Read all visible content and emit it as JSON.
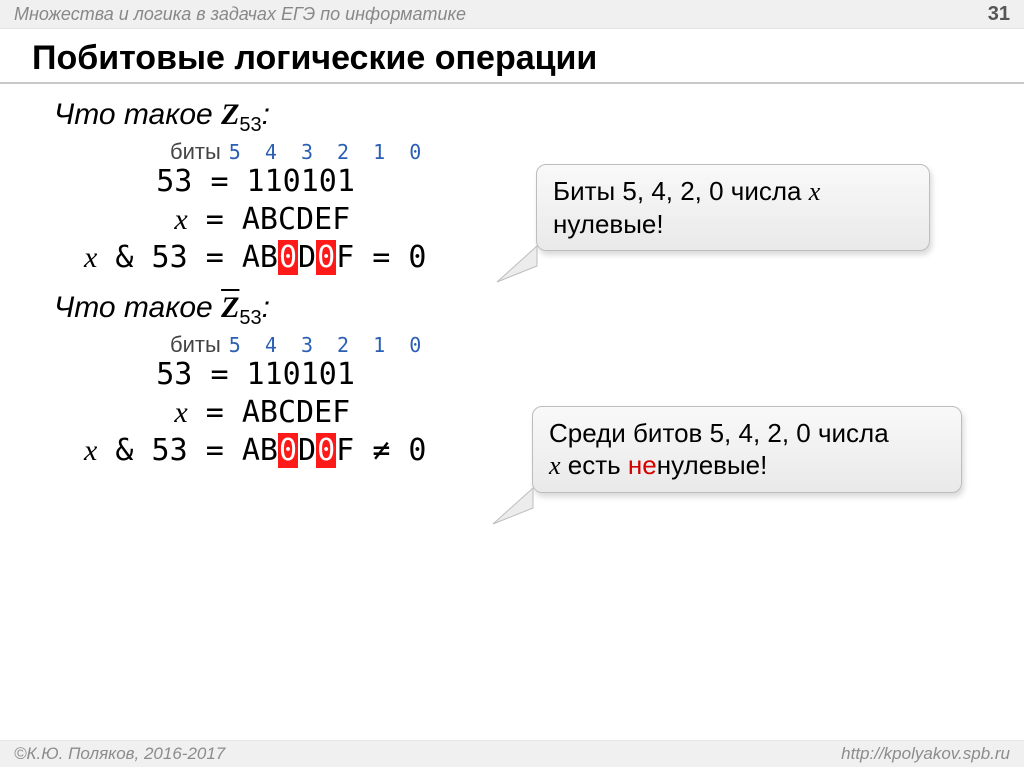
{
  "header": {
    "subject": "Множества и логика в задачах ЕГЭ по информатике",
    "page": "31"
  },
  "title": "Побитовые логические операции",
  "block1": {
    "question_prefix": "Что такое ",
    "z": "Z",
    "sub": "53",
    "colon": ":",
    "bits_label": "биты",
    "bits_nums": "5 4 3 2 1 0",
    "row1_lhs": "    53 ",
    "row1_eq": "=",
    "row1_rhs": " 110101",
    "row2_lhs_x": "x",
    "row2_eq": " =",
    "row2_rhs": " ABCDEF",
    "row3_lhs_x": "x",
    "row3_amp": " & 53 ",
    "row3_eq": "=",
    "row3_rhs_ab": " AB",
    "row3_rhs_0a": "0",
    "row3_rhs_d": "D",
    "row3_rhs_0b": "0",
    "row3_rhs_f": "F",
    "row3_tail": " = 0"
  },
  "block2": {
    "question_prefix": "Что такое ",
    "z": "Z",
    "sub": "53",
    "colon": ":",
    "bits_label": "биты",
    "bits_nums": "5 4 3 2 1 0",
    "row1_lhs": "    53 ",
    "row1_eq": "=",
    "row1_rhs": " 110101",
    "row2_lhs_x": "x",
    "row2_eq": " =",
    "row2_rhs": " ABCDEF",
    "row3_lhs_x": "x",
    "row3_amp": " & 53 ",
    "row3_eq": "=",
    "row3_rhs_ab": " AB",
    "row3_rhs_0a": "0",
    "row3_rhs_d": "D",
    "row3_rhs_0b": "0",
    "row3_rhs_f": "F",
    "row3_tail": " ≠ 0"
  },
  "callout1": {
    "l1a": "Биты 5, 4, 2, 0 числа ",
    "l1x": "x",
    "l2": "нулевые!"
  },
  "callout2": {
    "l1": "Среди битов 5, 4, 2, 0 числа",
    "l2x": "x",
    "l2a": " есть ",
    "l2red": "не",
    "l2b": "нулевые!"
  },
  "footer": {
    "left": "©К.Ю. Поляков, 2016-2017",
    "right": "http://kpolyakov.spb.ru"
  }
}
